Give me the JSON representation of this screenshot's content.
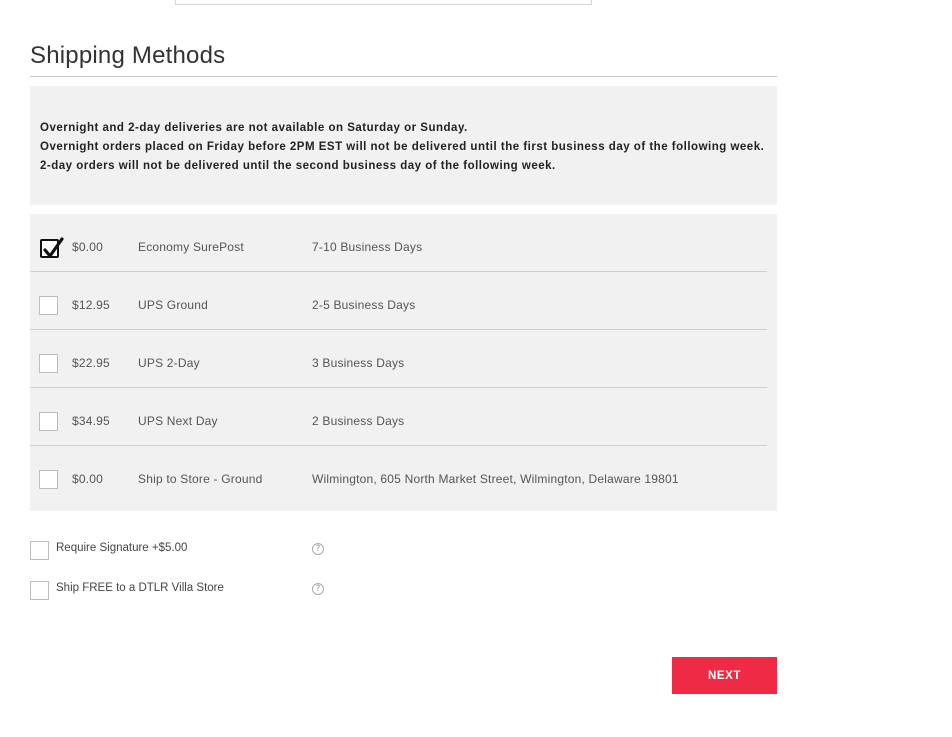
{
  "page": {
    "title": "Shipping Methods"
  },
  "notice": {
    "line1": "Overnight and 2-day deliveries are not available on Saturday or Sunday.",
    "line2": "Overnight orders placed on Friday before 2PM EST will not be delivered until the first business day of the following week. 2-day orders will not be delivered until the second business day of the following week."
  },
  "methods": [
    {
      "price": "$0.00",
      "name": "Economy SurePost",
      "days": "7-10 Business Days",
      "checked": true
    },
    {
      "price": "$12.95",
      "name": "UPS Ground",
      "days": "2-5 Business Days",
      "checked": false
    },
    {
      "price": "$22.95",
      "name": "UPS 2-Day",
      "days": "3 Business Days",
      "checked": false
    },
    {
      "price": "$34.95",
      "name": "UPS Next Day",
      "days": "2 Business Days",
      "checked": false
    },
    {
      "price": "$0.00",
      "name": "Ship to Store - Ground",
      "days": "Wilmington, 605 North Market Street, Wilmington, Delaware 19801",
      "checked": false
    }
  ],
  "options": [
    {
      "label": "Require Signature +$5.00",
      "help": "?"
    },
    {
      "label": "Ship FREE to a DTLR Villa Store",
      "help": "?"
    }
  ],
  "actions": {
    "next_label": "NEXT"
  },
  "colors": {
    "accent": "#ee2a45",
    "panel_bg": "#f1f1f1"
  }
}
